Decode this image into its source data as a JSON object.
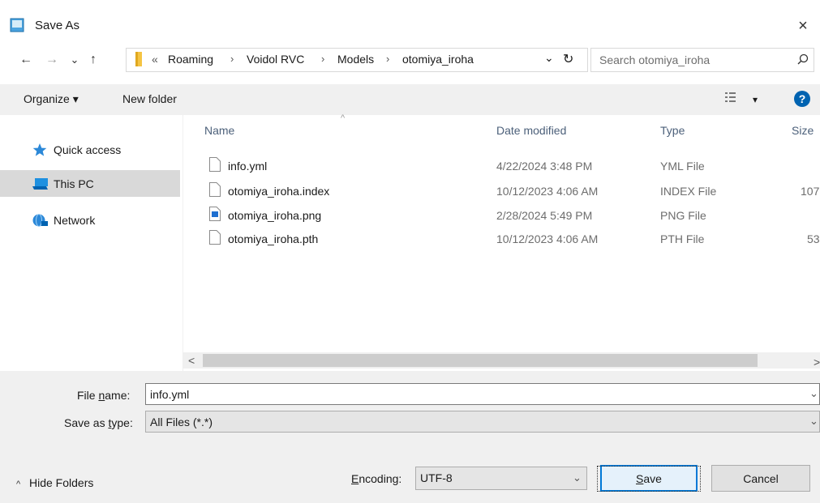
{
  "window": {
    "title": "Save As",
    "close": "×"
  },
  "nav": {
    "back": "←",
    "forward": "→",
    "recent": "⌄",
    "up": "↑",
    "breadcrumbs": [
      "«",
      "Roaming",
      "Voidol RVC",
      "Models",
      "otomiya_iroha"
    ],
    "dropdown": "⌄",
    "refresh": "↻",
    "search_placeholder": "Search otomiya_iroha",
    "search_icon": "⚲"
  },
  "toolbar": {
    "organize": "Organize ▾",
    "new_folder": "New folder",
    "view_caret": "▾",
    "help": "?"
  },
  "sidebar": {
    "items": [
      {
        "label": "Quick access",
        "icon": "star-icon"
      },
      {
        "label": "This PC",
        "icon": "computer-icon",
        "selected": true
      },
      {
        "label": "Network",
        "icon": "network-icon"
      }
    ]
  },
  "files": {
    "sort_caret": "^",
    "columns": [
      "Name",
      "Date modified",
      "Type",
      "Size"
    ],
    "rows": [
      {
        "name": "info.yml",
        "date": "4/22/2024 3:48 PM",
        "type": "YML File",
        "size": ""
      },
      {
        "name": "otomiya_iroha.index",
        "date": "10/12/2023 4:06 AM",
        "type": "INDEX File",
        "size": "107"
      },
      {
        "name": "otomiya_iroha.png",
        "date": "2/28/2024 5:49 PM",
        "type": "PNG File",
        "size": ""
      },
      {
        "name": "otomiya_iroha.pth",
        "date": "10/12/2023 4:06 AM",
        "type": "PTH File",
        "size": "53"
      }
    ],
    "scroll_left": "<",
    "scroll_right": ">"
  },
  "form": {
    "file_name_label_pre": "File ",
    "file_name_label_u": "n",
    "file_name_label_post": "ame:",
    "file_name_value": "info.yml",
    "save_type_label_pre": "Save as ",
    "save_type_label_u": "t",
    "save_type_label_post": "ype:",
    "save_type_value": "All Files (*.*)",
    "chevron": "⌄",
    "hide_folders": "Hide Folders",
    "hide_caret": "^",
    "encoding_label_u": "E",
    "encoding_label_post": "ncoding:",
    "encoding_value": "UTF-8",
    "save_u": "S",
    "save_post": "ave",
    "cancel": "Cancel"
  }
}
